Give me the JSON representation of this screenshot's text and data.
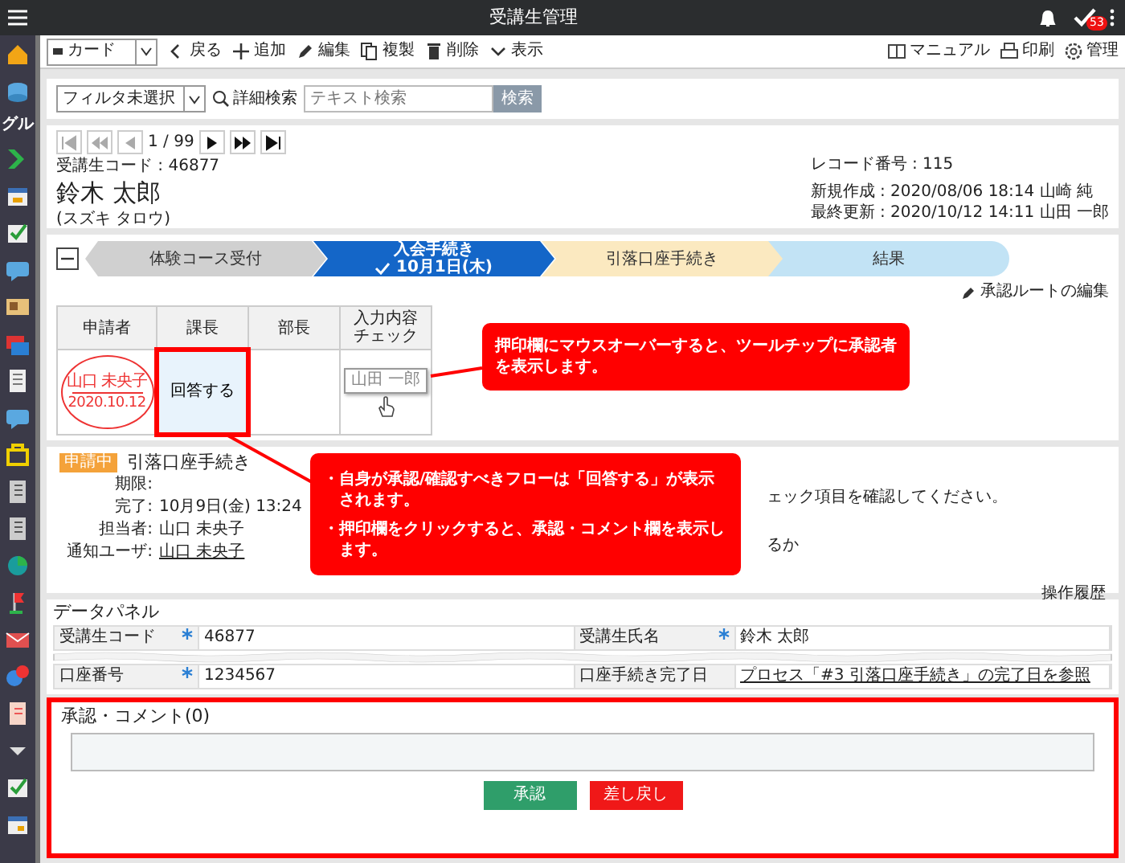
{
  "topbar": {
    "title": "受講生管理",
    "badge": "53"
  },
  "sidebar": {
    "label": "グル"
  },
  "toolbar": {
    "view": "カード",
    "actions": [
      {
        "label": "戻る",
        "kind": "back"
      },
      {
        "label": "追加",
        "kind": "add"
      },
      {
        "label": "編集",
        "kind": "edit"
      },
      {
        "label": "複製",
        "kind": "copy"
      },
      {
        "label": "削除",
        "kind": "delete"
      },
      {
        "label": "表示",
        "kind": "view"
      }
    ],
    "links": [
      {
        "label": "マニュアル",
        "kind": "manual"
      },
      {
        "label": "印刷",
        "kind": "print"
      },
      {
        "label": "管理",
        "kind": "settings"
      }
    ]
  },
  "filter": {
    "select": "フィルタ未選択",
    "advanced": "詳細検索",
    "search_placeholder": "テキスト検索",
    "search_button": "検索"
  },
  "record": {
    "page": "1 / 99",
    "code": "受講生コード : 46877",
    "name": "鈴木 太郎",
    "kana": "(スズキ タロウ)",
    "number": "レコード番号 : 115",
    "created": "新規作成 : 2020/08/06 18:14 山崎 純",
    "updated": "最終更新 : 2020/10/12 14:11 山田 一郎"
  },
  "process": {
    "steps": [
      {
        "label": "体験コース受付",
        "kind": "done",
        "selected": false
      },
      {
        "label": "入会手続き",
        "date": "10月1日(木)",
        "kind": "current",
        "selected": true
      },
      {
        "label": "引落口座手続き",
        "kind": "next",
        "selected": false
      },
      {
        "label": "結果",
        "kind": "result",
        "selected": false
      }
    ],
    "edit_route": "承認ルートの編集",
    "approval": {
      "columns": [
        "申請者",
        "課長",
        "部長",
        "入力内容チェック"
      ],
      "cells": [
        {
          "kind": "stamp",
          "name": "山口 未央子",
          "date": "2020.10.12"
        },
        {
          "kind": "answer",
          "label": "回答する",
          "highlighted": true
        },
        {
          "kind": "empty"
        },
        {
          "kind": "mini_stamp",
          "name": "山田 一郎"
        }
      ]
    }
  },
  "task": {
    "status": "申請中",
    "title": "引落口座手続き",
    "fields": [
      {
        "label": "期限:"
      },
      {
        "label": "完了:",
        "value": "10月9日(金) 13:24",
        "link": false
      },
      {
        "label": "担当者:",
        "value": "山口 未央子",
        "link": false
      },
      {
        "label": "通知ユーザ:",
        "value": "山口 未央子",
        "link": true
      }
    ],
    "notes": [
      "ェック項目を確認してください。",
      "るか"
    ],
    "history": "操作履歴"
  },
  "data_panel": {
    "title": "データパネル",
    "rows": [
      {
        "cells": [
          {
            "label": "受講生コード",
            "required": true,
            "value": "46877",
            "link": false
          },
          {
            "label": "受講生氏名",
            "required": true,
            "value": "鈴木 太郎",
            "link": false
          }
        ]
      },
      {
        "cells": [
          {
            "label": "口座番号",
            "required": true,
            "value": "1234567",
            "link": false
          },
          {
            "label": "口座手続き完了日",
            "required": false,
            "value": "プロセス「#3 引落口座手続き」の完了日を参照",
            "link": true
          }
        ]
      }
    ]
  },
  "comments": {
    "title": "承認・コメント(0)",
    "buttons": [
      {
        "label": "承認",
        "kind": "approve"
      },
      {
        "label": "差し戻し",
        "kind": "reject"
      }
    ]
  },
  "callouts": [
    {
      "items": [
        "押印欄にマウスオーバーすると、ツールチップに承認者を表示します。"
      ]
    },
    {
      "items": [
        "・自身が承認/確認すべきフローは「回答する」が表示されます。",
        "・押印欄をクリックすると、承認・コメント欄を表示します。"
      ]
    }
  ]
}
